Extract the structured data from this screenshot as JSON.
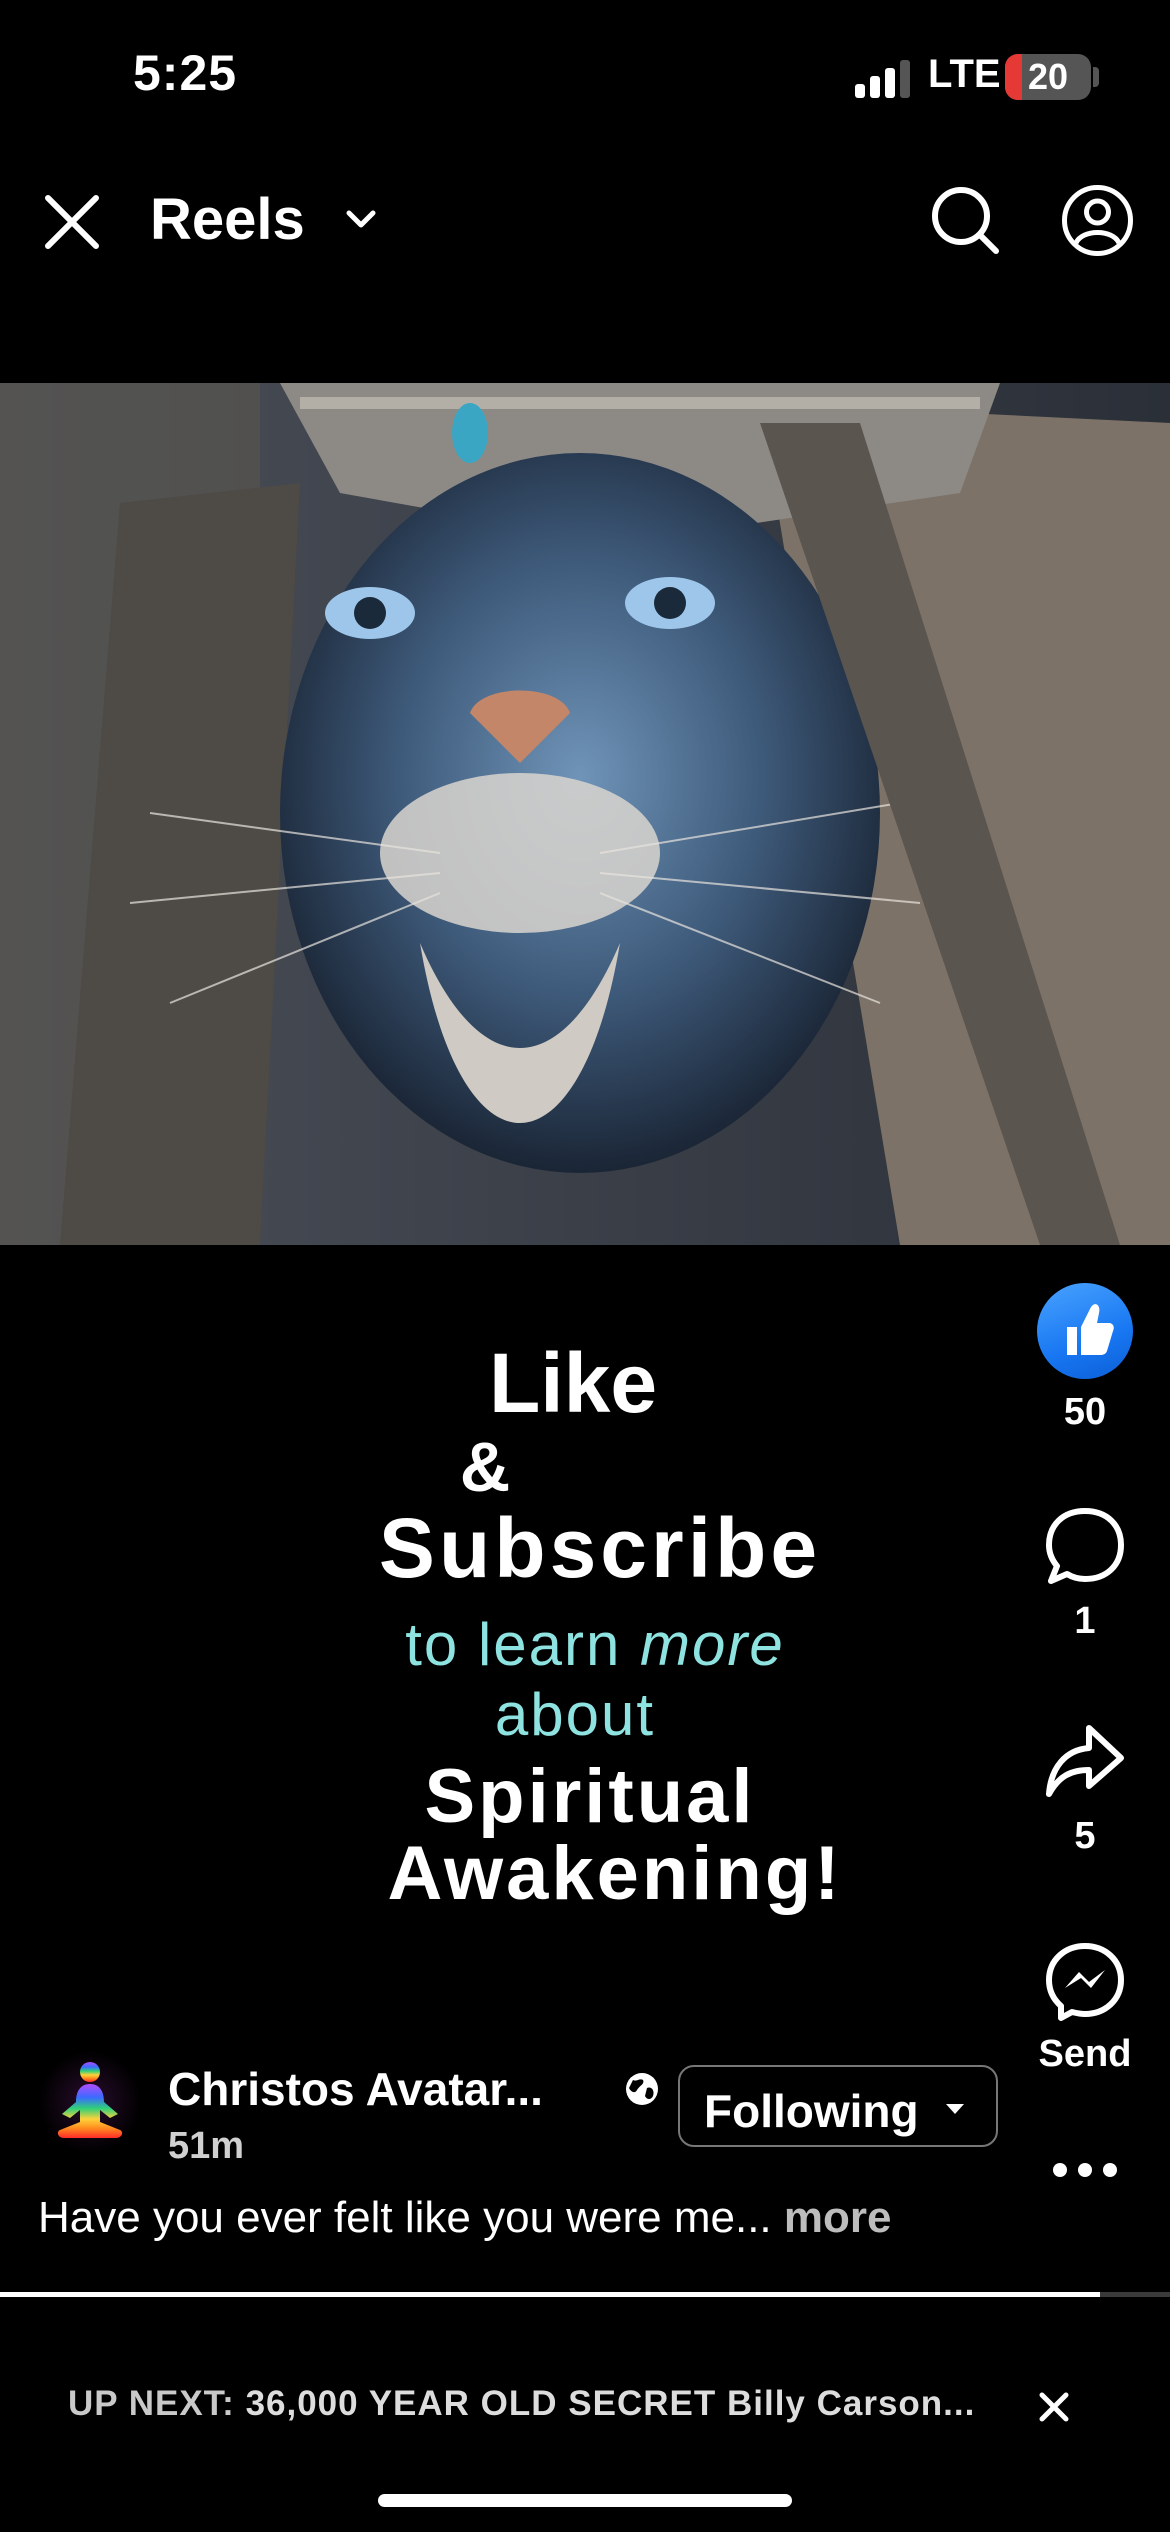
{
  "status_bar": {
    "time": "5:25",
    "network": "LTE",
    "battery": "20",
    "battery_level": 0.2,
    "signal_bars_active": 3
  },
  "header": {
    "title": "Reels"
  },
  "video_overlay": {
    "line1": "Like",
    "line2": "&",
    "line3": "Subscribe",
    "line4_a": "to learn ",
    "line4_b": "more",
    "line5": "about",
    "line6": "Spiritual",
    "line7": "Awakening!"
  },
  "actions": {
    "like_count": "50",
    "comment_count": "1",
    "share_count": "5",
    "send_label": "Send"
  },
  "author": {
    "name": "Christos Avatar...",
    "time": "51m",
    "follow_label": "Following"
  },
  "caption": {
    "text": "Have you ever felt like you were me... ",
    "more": "more"
  },
  "progress": {
    "fraction": 0.94
  },
  "up_next": {
    "prefix": "UP NEXT: ",
    "title": "36,000 YEAR OLD SECRET Billy Carson..."
  },
  "colors": {
    "like_blue": "#1877f2",
    "overlay_cyan": "#8ee3e0",
    "battery_red": "#e53935"
  }
}
